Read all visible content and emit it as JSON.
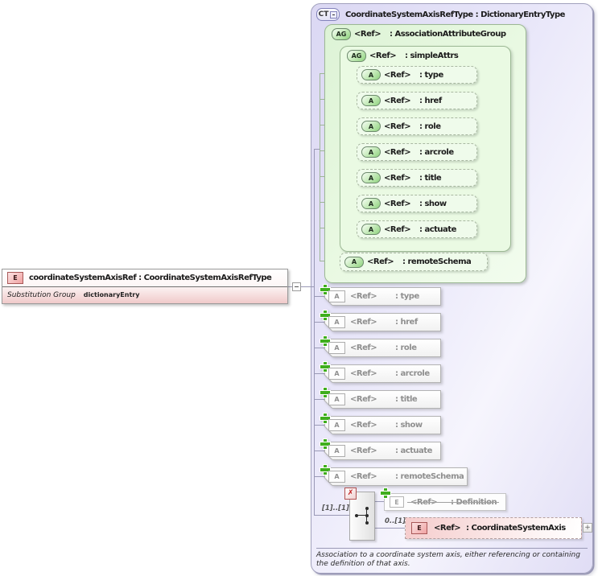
{
  "colors": {
    "panel_lavender": "#e6e4f8",
    "group_green": "#e4f6de",
    "element_pink": "#f0caca",
    "plus_green": "#3fae1d",
    "remove_red": "#c01818"
  },
  "icons": {
    "expand_box": "+",
    "remove_x": "✗"
  },
  "element": {
    "badge": "E",
    "title": "coordinateSystemAxisRef : CoordinateSystemAxisRefType",
    "substitution_group_label": "Substitution Group",
    "substitution_group_value": "dictionaryEntry"
  },
  "ct": {
    "badge": "CT",
    "title": "CoordinateSystemAxisRefType : DictionaryEntryType",
    "association_group": {
      "badge": "AG",
      "ref": "<Ref>",
      "name": ": AssociationAttributeGroup"
    },
    "simple_attrs": {
      "badge": "AG",
      "ref": "<Ref>",
      "name": ": simpleAttrs",
      "attrs": [
        {
          "badge": "A",
          "ref": "<Ref>",
          "name": ": type"
        },
        {
          "badge": "A",
          "ref": "<Ref>",
          "name": ": href"
        },
        {
          "badge": "A",
          "ref": "<Ref>",
          "name": ": role"
        },
        {
          "badge": "A",
          "ref": "<Ref>",
          "name": ": arcrole"
        },
        {
          "badge": "A",
          "ref": "<Ref>",
          "name": ": title"
        },
        {
          "badge": "A",
          "ref": "<Ref>",
          "name": ": show"
        },
        {
          "badge": "A",
          "ref": "<Ref>",
          "name": ": actuate"
        }
      ]
    },
    "remote_schema_attr": {
      "badge": "A",
      "ref": "<Ref>",
      "name": ": remoteSchema"
    },
    "own_attrs": [
      {
        "badge": "A",
        "ref": "<Ref>",
        "name": ": type"
      },
      {
        "badge": "A",
        "ref": "<Ref>",
        "name": ": href"
      },
      {
        "badge": "A",
        "ref": "<Ref>",
        "name": ": role"
      },
      {
        "badge": "A",
        "ref": "<Ref>",
        "name": ": arcrole"
      },
      {
        "badge": "A",
        "ref": "<Ref>",
        "name": ": title"
      },
      {
        "badge": "A",
        "ref": "<Ref>",
        "name": ": show"
      },
      {
        "badge": "A",
        "ref": "<Ref>",
        "name": ": actuate"
      },
      {
        "badge": "A",
        "ref": "<Ref>",
        "name": ": remoteSchema"
      }
    ],
    "model": {
      "cardinality": "[1]..[1]",
      "definition": {
        "badge": "E",
        "ref": "<Ref>",
        "name": ": Definition"
      },
      "axis": {
        "badge": "E",
        "ref": "<Ref>",
        "name": ": CoordinateSystemAxis",
        "cardinality": "0..[1]"
      }
    },
    "annotation": "Association to a coordinate system axis, either referencing or containing the definition of that axis."
  }
}
